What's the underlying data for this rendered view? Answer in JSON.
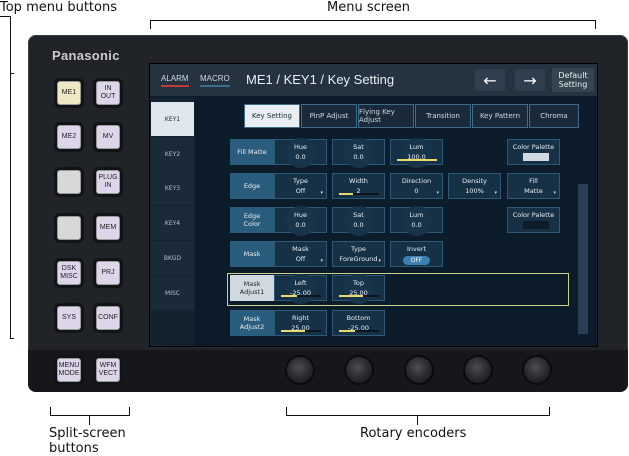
{
  "annotations": {
    "top_menu_buttons": "Top menu buttons",
    "menu_screen": "Menu screen",
    "split_screen_buttons": "Split-screen\nbuttons",
    "rotary_encoders": "Rotary encoders"
  },
  "brand": "Panasonic",
  "hardware_buttons": [
    "ME1",
    "IN\nOUT",
    "ME2",
    "MV",
    "",
    "PLUG\nIN",
    "",
    "MEM",
    "DSK\nMISC",
    "PRJ",
    "SYS",
    "CONF"
  ],
  "split_buttons": [
    "MENU\nMODE",
    "WFM\nVECT"
  ],
  "screen": {
    "alarm": "ALARM",
    "macro": "MACRO",
    "title": "ME1 / KEY1 / Key Setting",
    "back_arrow": "←",
    "forward_arrow": "→",
    "default_setting": "Default\nSetting",
    "side_tabs": [
      "KEY1",
      "KEY2",
      "KEY3",
      "KEY4",
      "BKGD",
      "MISC"
    ],
    "tabs": [
      "Key Setting",
      "PinP Adjust",
      "Flying Key Adjust",
      "Transition",
      "Key Pattern",
      "Chroma"
    ],
    "rows": {
      "fill_matte": {
        "label": "Fill Matte",
        "hue": {
          "name": "Hue",
          "value": "0.0"
        },
        "sat": {
          "name": "Sat",
          "value": "0.0"
        },
        "lum": {
          "name": "Lum",
          "value": "100.0",
          "level": 1.0
        },
        "palette": "Color Palette"
      },
      "edge": {
        "label": "Edge",
        "type": {
          "name": "Type",
          "value": "Off"
        },
        "width": {
          "name": "Width",
          "value": "2",
          "level": 0.35
        },
        "direction": {
          "name": "Direction",
          "value": "0"
        },
        "density": {
          "name": "Density",
          "value": "100%"
        },
        "fill": {
          "name": "Fill",
          "value": "Matte"
        }
      },
      "edge_color": {
        "label": "Edge\nColor",
        "hue": {
          "name": "Hue",
          "value": "0.0"
        },
        "sat": {
          "name": "Sat",
          "value": "0.0"
        },
        "lum": {
          "name": "Lum",
          "value": "0.0"
        },
        "palette": "Color Palette"
      },
      "mask": {
        "label": "Mask",
        "mask": {
          "name": "Mask",
          "value": "Off"
        },
        "type": {
          "name": "Type",
          "value": "ForeGround"
        },
        "invert": {
          "name": "Invert",
          "value": "OFF"
        }
      },
      "mask_adjust1": {
        "label": "Mask\nAdjust1",
        "left": {
          "name": "Left",
          "value": "-25.00",
          "level": 0.4
        },
        "top": {
          "name": "Top",
          "value": "25.00",
          "level": 0.6
        }
      },
      "mask_adjust2": {
        "label": "Mask\nAdjust2",
        "right": {
          "name": "Right",
          "value": "25.00",
          "level": 0.6
        },
        "bottom": {
          "name": "Bottom",
          "value": "-25.00",
          "level": 0.4
        }
      }
    }
  },
  "colors": {
    "accent_fill": "#e9d86a",
    "fill_matte_palette": "#cfd9df",
    "edge_color_palette": "#0f1b26"
  }
}
